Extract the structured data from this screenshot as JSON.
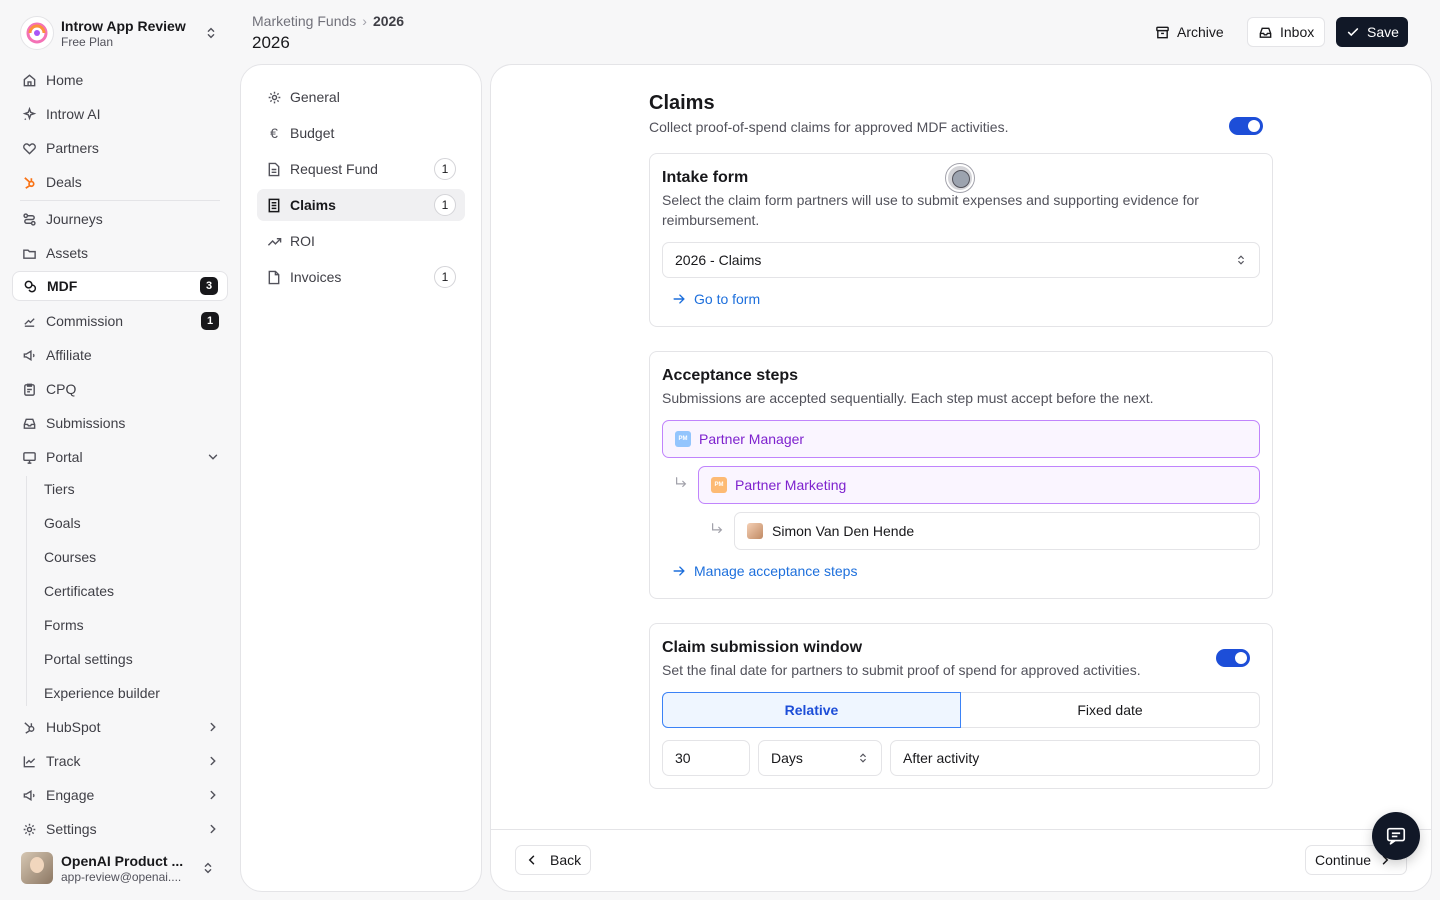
{
  "workspace": {
    "name": "Introw App Review",
    "plan": "Free Plan"
  },
  "sidebar": {
    "items": [
      {
        "label": "Home"
      },
      {
        "label": "Introw AI"
      },
      {
        "label": "Partners"
      },
      {
        "label": "Deals"
      },
      {
        "label": "Journeys"
      },
      {
        "label": "Assets"
      },
      {
        "label": "MDF",
        "badge": "3"
      },
      {
        "label": "Commission",
        "badge": "1"
      },
      {
        "label": "Affiliate"
      },
      {
        "label": "CPQ"
      },
      {
        "label": "Submissions"
      },
      {
        "label": "Portal"
      }
    ],
    "portal_sub": [
      "Tiers",
      "Goals",
      "Courses",
      "Certificates",
      "Forms",
      "Portal settings",
      "Experience builder"
    ],
    "bottom_items": [
      {
        "label": "HubSpot"
      },
      {
        "label": "Track"
      },
      {
        "label": "Engage"
      },
      {
        "label": "Settings"
      }
    ]
  },
  "user": {
    "name": "OpenAI Product ...",
    "email": "app-review@openai...."
  },
  "header": {
    "breadcrumb_parent": "Marketing Funds",
    "breadcrumb_current": "2026",
    "title": "2026",
    "archive_label": "Archive",
    "inbox_label": "Inbox",
    "save_label": "Save"
  },
  "sections": [
    {
      "label": "General"
    },
    {
      "label": "Budget"
    },
    {
      "label": "Request Fund",
      "count": "1"
    },
    {
      "label": "Claims",
      "count": "1"
    },
    {
      "label": "ROI"
    },
    {
      "label": "Invoices",
      "count": "1"
    }
  ],
  "claims": {
    "title": "Claims",
    "description": "Collect proof-of-spend claims for approved MDF activities.",
    "enabled": true,
    "intake": {
      "title": "Intake form",
      "description": "Select the claim form partners will use to submit expenses and supporting evidence for reimbursement.",
      "selected_form": "2026 - Claims",
      "go_to_form": "Go to form"
    },
    "acceptance": {
      "title": "Acceptance steps",
      "description": "Submissions are accepted sequentially. Each step must accept before the next.",
      "steps": [
        "Partner Manager",
        "Partner Marketing",
        "Simon Van Den Hende"
      ],
      "tags": [
        "PM",
        "PM"
      ],
      "tag_colors": [
        "#93c5fd",
        "#fdba74"
      ],
      "manage_link": "Manage acceptance steps"
    },
    "window": {
      "title": "Claim submission window",
      "description": "Set the final date for partners to submit proof of spend for approved activities.",
      "enabled": true,
      "mode_options": [
        "Relative",
        "Fixed date"
      ],
      "selected_mode": "Relative",
      "amount": "30",
      "unit": "Days",
      "reference": "After activity"
    }
  },
  "footer": {
    "back_label": "Back",
    "continue_label": "Continue"
  },
  "colors": {
    "accent": "#1d4ed8",
    "link": "#1d6fdc",
    "step_border": "#c084fc"
  }
}
